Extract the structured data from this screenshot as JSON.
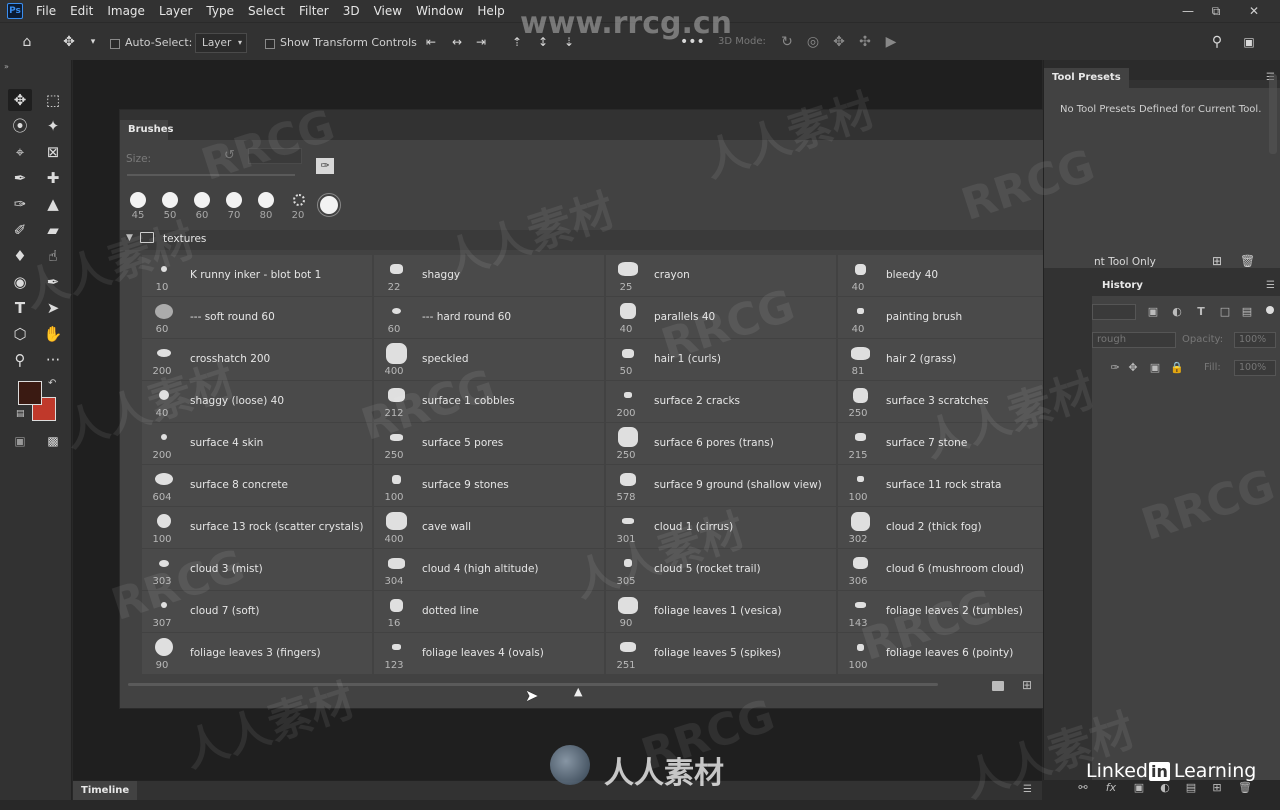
{
  "menubar": {
    "logo": "Ps",
    "items": [
      "File",
      "Edit",
      "Image",
      "Layer",
      "Type",
      "Select",
      "Filter",
      "3D",
      "View",
      "Window",
      "Help"
    ]
  },
  "options": {
    "auto_select_label": "Auto-Select:",
    "auto_select_value": "Layer",
    "transform_label": "Show Transform Controls",
    "mode_label": "3D Mode:"
  },
  "brushes": {
    "tab": "Brushes",
    "size_label": "Size:",
    "recent": [
      "45",
      "50",
      "60",
      "70",
      "80",
      "20"
    ],
    "group": "textures",
    "items": [
      {
        "num": "10",
        "name": "K runny inker - blot bot 1"
      },
      {
        "num": "22",
        "name": "shaggy"
      },
      {
        "num": "25",
        "name": "crayon"
      },
      {
        "num": "40",
        "name": "bleedy 40"
      },
      {
        "num": "60",
        "name": "--- soft round 60"
      },
      {
        "num": "60",
        "name": "--- hard round 60"
      },
      {
        "num": "40",
        "name": "parallels 40"
      },
      {
        "num": "40",
        "name": "painting brush"
      },
      {
        "num": "200",
        "name": "crosshatch 200"
      },
      {
        "num": "400",
        "name": "speckled"
      },
      {
        "num": "50",
        "name": "hair 1 (curls)"
      },
      {
        "num": "81",
        "name": "hair 2 (grass)"
      },
      {
        "num": "40",
        "name": "shaggy (loose) 40"
      },
      {
        "num": "212",
        "name": "surface 1 cobbles"
      },
      {
        "num": "200",
        "name": "surface 2 cracks"
      },
      {
        "num": "250",
        "name": "surface 3 scratches"
      },
      {
        "num": "200",
        "name": "surface 4 skin"
      },
      {
        "num": "250",
        "name": "surface 5 pores"
      },
      {
        "num": "250",
        "name": "surface 6 pores (trans)"
      },
      {
        "num": "215",
        "name": "surface 7 stone"
      },
      {
        "num": "604",
        "name": "surface 8 concrete"
      },
      {
        "num": "100",
        "name": "surface 9 stones"
      },
      {
        "num": "578",
        "name": "surface 9 ground (shallow view)"
      },
      {
        "num": "100",
        "name": "surface 11 rock strata"
      },
      {
        "num": "100",
        "name": "surface 13 rock (scatter crystals)"
      },
      {
        "num": "400",
        "name": "cave wall"
      },
      {
        "num": "301",
        "name": "cloud 1 (cirrus)"
      },
      {
        "num": "302",
        "name": "cloud 2 (thick fog)"
      },
      {
        "num": "303",
        "name": "cloud 3 (mist)"
      },
      {
        "num": "304",
        "name": "cloud 4 (high altitude)"
      },
      {
        "num": "305",
        "name": "cloud 5 (rocket trail)"
      },
      {
        "num": "306",
        "name": "cloud 6 (mushroom cloud)"
      },
      {
        "num": "307",
        "name": "cloud 7 (soft)"
      },
      {
        "num": "16",
        "name": "dotted line"
      },
      {
        "num": "90",
        "name": "foliage leaves 1 (vesica)"
      },
      {
        "num": "143",
        "name": "foliage leaves 2 (tumbles)"
      },
      {
        "num": "90",
        "name": "foliage leaves 3 (fingers)"
      },
      {
        "num": "123",
        "name": "foliage leaves 4 (ovals)"
      },
      {
        "num": "251",
        "name": "foliage leaves 5 (spikes)"
      },
      {
        "num": "100",
        "name": "foliage leaves 6 (pointy)"
      }
    ]
  },
  "right": {
    "tool_presets_tab": "Tool Presets",
    "tool_presets_msg": "No Tool Presets Defined for Current Tool.",
    "current_tool_only": "nt Tool Only",
    "history_tab": "History",
    "blend_mode": "rough",
    "opacity_label": "Opacity:",
    "opacity_value": "100%",
    "fill_label": "Fill:",
    "fill_value": "100%"
  },
  "timeline": {
    "tab": "Timeline"
  },
  "watermarks": {
    "site": "www.rrcg.cn",
    "brand": "RRCG",
    "cn": "人人素材",
    "linkedin": "Linked",
    "linkedin_in": "in",
    "learning": "Learning"
  },
  "colors": {
    "foreground": "#3a1a12",
    "background": "#c0392b",
    "accent": "#3a8ef0"
  }
}
